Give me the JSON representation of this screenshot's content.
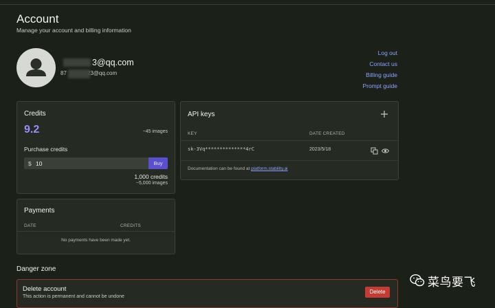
{
  "header": {
    "title": "Account",
    "subtitle": "Manage your account and billing information"
  },
  "profile": {
    "email_visible": "@qq.com",
    "email_prefix_partial": "3",
    "secondary_visible_prefix": "87",
    "secondary_visible_suffix": "23@qq.com"
  },
  "links": [
    "Log out",
    "Contact us",
    "Billing guide",
    "Prompt guide"
  ],
  "credits": {
    "title": "Credits",
    "value": "9.2",
    "images": "~45 images",
    "purchase_label": "Purchase credits",
    "currency": "$",
    "amount": "10",
    "buy_label": "Buy",
    "total": "1,000 credits",
    "total_images": "~5,000 images"
  },
  "api_keys": {
    "title": "API keys",
    "col_key": "KEY",
    "col_date": "DATE CREATED",
    "key": "sk-3Vq**************4rC",
    "date": "2023/5/18",
    "doc_prefix": "Documentation can be found at",
    "doc_link": "platform.stability.ai"
  },
  "payments": {
    "title": "Payments",
    "col_date": "DATE",
    "col_credits": "CREDITS",
    "empty": "No payments have been made yet."
  },
  "danger": {
    "heading": "Danger zone",
    "delete_title": "Delete account",
    "delete_sub": "This action is permanent and cannot be undone",
    "delete_button": "Delete"
  },
  "watermark": {
    "text": "菜鸟要飞"
  },
  "colors": {
    "accent": "#9c8cff",
    "link": "#8ea3ff",
    "buy": "#5a4fcf",
    "danger": "#c63a32"
  }
}
